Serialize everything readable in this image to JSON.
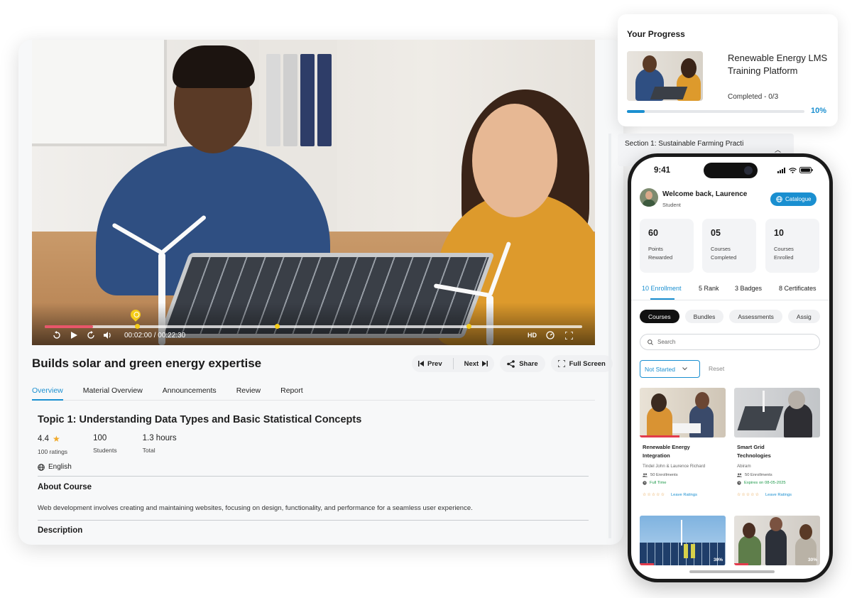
{
  "video": {
    "time": "00:02:00 / 00:22:30",
    "hd_label": "HD"
  },
  "course": {
    "title": "Builds solar and green energy expertise",
    "actions": {
      "prev": "Prev",
      "next": "Next",
      "share": "Share",
      "fullscreen": "Full Screen"
    },
    "tabs": [
      "Overview",
      "Material Overview",
      "Announcements",
      "Review",
      "Report"
    ],
    "topic": "Topic 1: Understanding Data Types and Basic Statistical Concepts",
    "stats": [
      {
        "value": "4.4",
        "label": "100 ratings"
      },
      {
        "value": "100",
        "label": "Students"
      },
      {
        "value": "1.3 hours",
        "label": "Total"
      }
    ],
    "language": "English",
    "about_heading": "About Course",
    "about_text": "Web development involves creating and maintaining websites, focusing on design, functionality, and performance for a seamless user experience.",
    "description_heading": "Description"
  },
  "section": {
    "title": "Section 1: Sustainable Farming Practi"
  },
  "progress": {
    "heading": "Your Progress",
    "course_title": "Renewable Energy LMS Training Platform",
    "status": "Completed - 0/3",
    "percent_label": "10%",
    "percent": 10
  },
  "phone": {
    "time": "9:41",
    "welcome": "Welcome back, Laurence",
    "role": "Student",
    "catalogue": "Catalogue",
    "stats": [
      {
        "number": "60",
        "label1": "Points",
        "label2": "Rewarded"
      },
      {
        "number": "05",
        "label1": "Courses",
        "label2": "Completed"
      },
      {
        "number": "10",
        "label1": "Courses",
        "label2": "Enrolled"
      }
    ],
    "tabs": [
      "10 Enrollment",
      "5 Rank",
      "3 Badges",
      "8 Certificates"
    ],
    "chips": [
      "Courses",
      "Bundles",
      "Assessments",
      "Assig"
    ],
    "search_placeholder": "Search",
    "filter": "Not Started",
    "reset": "Reset",
    "courses": [
      {
        "title1": "Renewable Energy",
        "title2": "Integration",
        "authors": "Tindel John & Laurence Richard",
        "enrollments": "50 Enrollments",
        "meta": "Full Time",
        "rating_label": "Leave Ratings"
      },
      {
        "title1": "Smart Grid",
        "title2": "Technologies",
        "authors": "Abiram",
        "enrollments": "50 Enrollments",
        "meta": "Expires on 08-05-2025",
        "rating_label": "Leave Ratings"
      },
      {
        "percent_label": "30%"
      },
      {
        "percent_label": "30%"
      }
    ]
  },
  "colors": {
    "accent": "#1a8fd0",
    "marker": "#f5cc18",
    "played": "#e8566a"
  }
}
